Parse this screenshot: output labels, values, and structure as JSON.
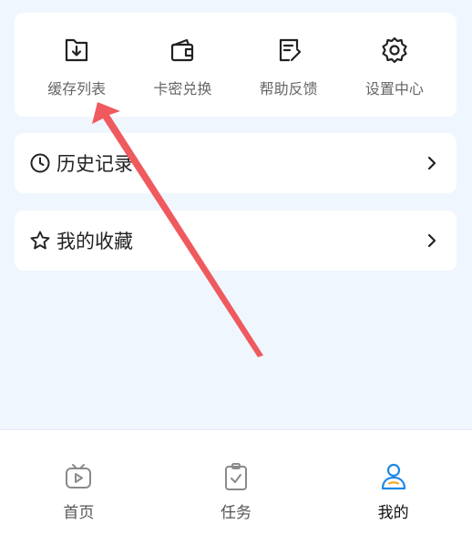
{
  "quick_actions": [
    {
      "label": "缓存列表",
      "icon": "download-box-icon"
    },
    {
      "label": "卡密兑换",
      "icon": "wallet-icon"
    },
    {
      "label": "帮助反馈",
      "icon": "edit-note-icon"
    },
    {
      "label": "设置中心",
      "icon": "gear-icon"
    }
  ],
  "rows": {
    "history": {
      "label": "历史记录",
      "icon": "clock-icon"
    },
    "favorites": {
      "label": "我的收藏",
      "icon": "star-icon"
    }
  },
  "tabbar": {
    "active_color": "#1e88e5",
    "items": [
      {
        "label": "首页",
        "icon": "tv-play-icon"
      },
      {
        "label": "任务",
        "icon": "clipboard-check-icon"
      },
      {
        "label": "我的",
        "icon": "user-icon",
        "active": true
      }
    ]
  },
  "annotation": {
    "arrow_color": "#ef5a5f"
  }
}
